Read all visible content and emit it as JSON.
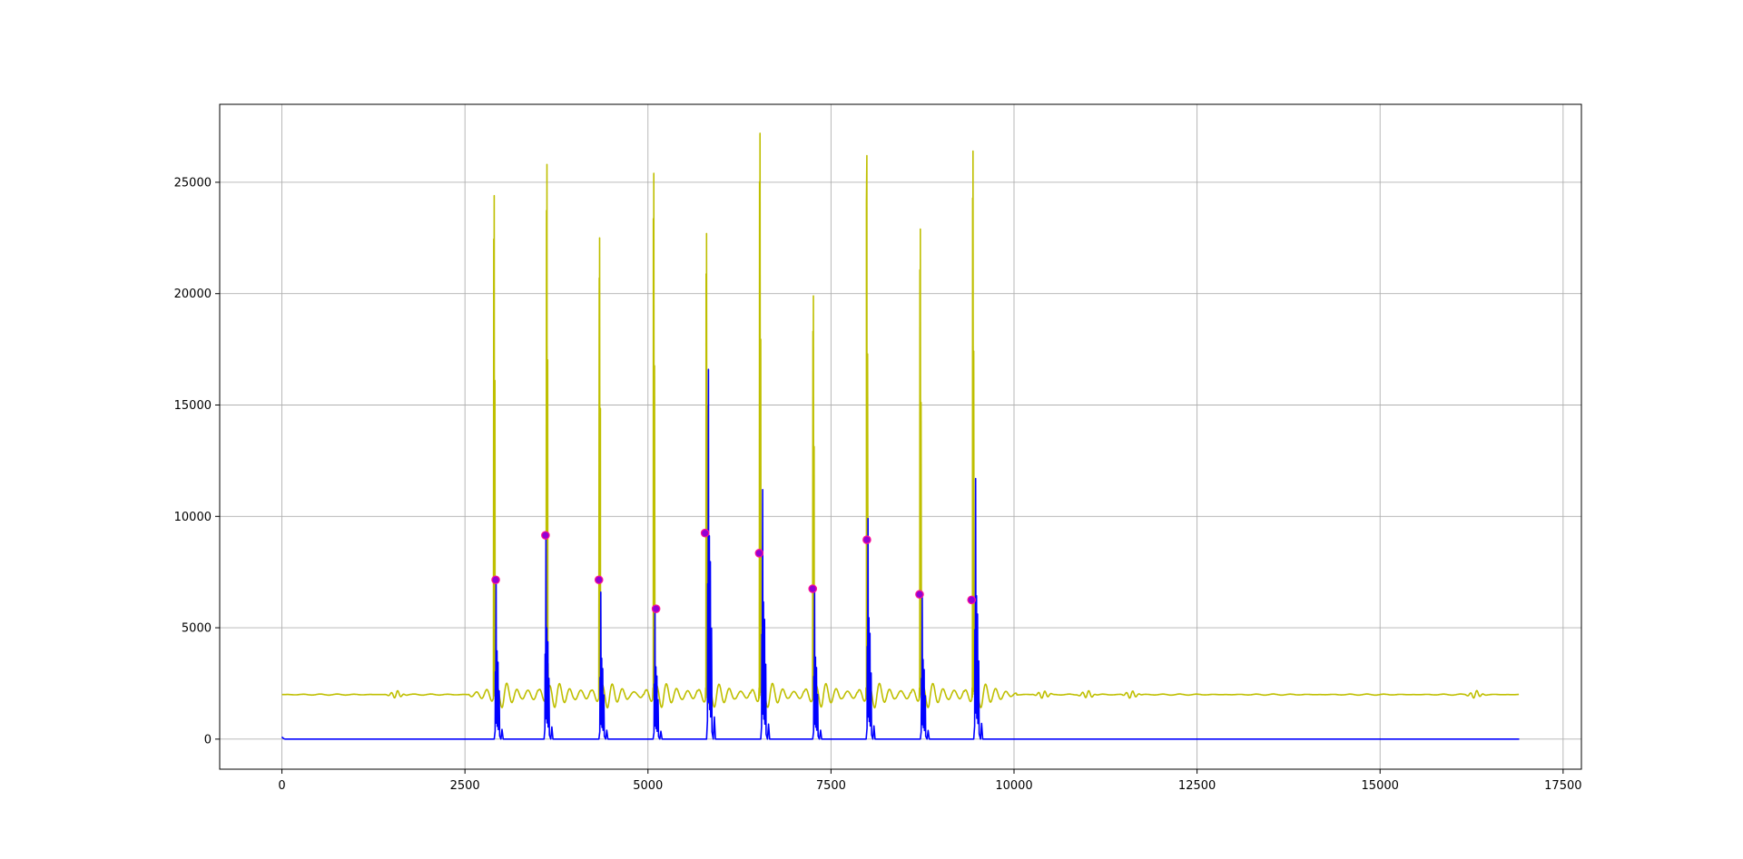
{
  "chart_data": {
    "type": "line",
    "title": "",
    "xlabel": "",
    "ylabel": "",
    "xlim": [
      -850,
      17750
    ],
    "ylim": [
      -1350,
      28500
    ],
    "xticks": [
      0,
      2500,
      5000,
      7500,
      10000,
      12500,
      15000,
      17500
    ],
    "xtick_labels": [
      "0",
      "2500",
      "5000",
      "7500",
      "10000",
      "12500",
      "15000",
      "17500"
    ],
    "yticks": [
      0,
      5000,
      10000,
      15000,
      20000,
      25000
    ],
    "ytick_labels": [
      "0",
      "5000",
      "10000",
      "15000",
      "20000",
      "25000"
    ],
    "grid": true,
    "legend": "none",
    "colors": {
      "olive": "#bfbf00",
      "blue": "#0000ff",
      "marker": "#9400d3",
      "marker_edge": "#ff1493",
      "grid": "#b0b0b0"
    },
    "series": [
      {
        "color": "#bfbf00",
        "baseline": 2000,
        "x_end": 16900,
        "bursts": [
          {
            "x": 2900,
            "peak": 24400
          },
          {
            "x": 3620,
            "peak": 25800
          },
          {
            "x": 4340,
            "peak": 22500
          },
          {
            "x": 5080,
            "peak": 25400
          },
          {
            "x": 5800,
            "peak": 22700
          },
          {
            "x": 6530,
            "peak": 27200
          },
          {
            "x": 7260,
            "peak": 19900
          },
          {
            "x": 7990,
            "peak": 26200
          },
          {
            "x": 8720,
            "peak": 22900
          },
          {
            "x": 9440,
            "peak": 26400
          }
        ]
      },
      {
        "color": "#0000ff",
        "baseline": 0,
        "x_end": 16900,
        "bursts": [
          {
            "x": 2920,
            "peak": 7200
          },
          {
            "x": 3600,
            "peak": 9100
          },
          {
            "x": 4350,
            "peak": 6600
          },
          {
            "x": 5090,
            "peak": 5900
          },
          {
            "x": 5820,
            "peak": 16600
          },
          {
            "x": 6560,
            "peak": 11200
          },
          {
            "x": 7270,
            "peak": 6700
          },
          {
            "x": 8000,
            "peak": 9900
          },
          {
            "x": 8740,
            "peak": 6500
          },
          {
            "x": 9470,
            "peak": 11700
          }
        ]
      }
    ],
    "markers": [
      {
        "x": 2920,
        "y": 7150
      },
      {
        "x": 3600,
        "y": 9150
      },
      {
        "x": 4330,
        "y": 7150
      },
      {
        "x": 5110,
        "y": 5850
      },
      {
        "x": 5780,
        "y": 9250
      },
      {
        "x": 6520,
        "y": 8350
      },
      {
        "x": 7250,
        "y": 6750
      },
      {
        "x": 7990,
        "y": 8950
      },
      {
        "x": 8710,
        "y": 6500
      },
      {
        "x": 9420,
        "y": 6250
      }
    ]
  }
}
